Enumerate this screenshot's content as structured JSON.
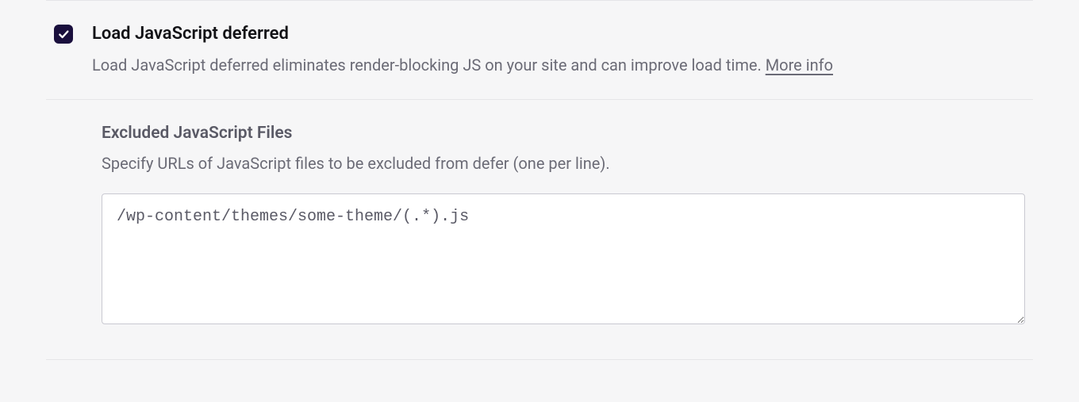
{
  "option": {
    "title": "Load JavaScript deferred",
    "description": "Load JavaScript deferred eliminates render-blocking JS on your site and can improve load time. ",
    "more_info": "More info",
    "checked": true
  },
  "excluded": {
    "title": "Excluded JavaScript Files",
    "description": "Specify URLs of JavaScript files to be excluded from defer (one per line).",
    "value": "/wp-content/themes/some-theme/(.*).js"
  }
}
